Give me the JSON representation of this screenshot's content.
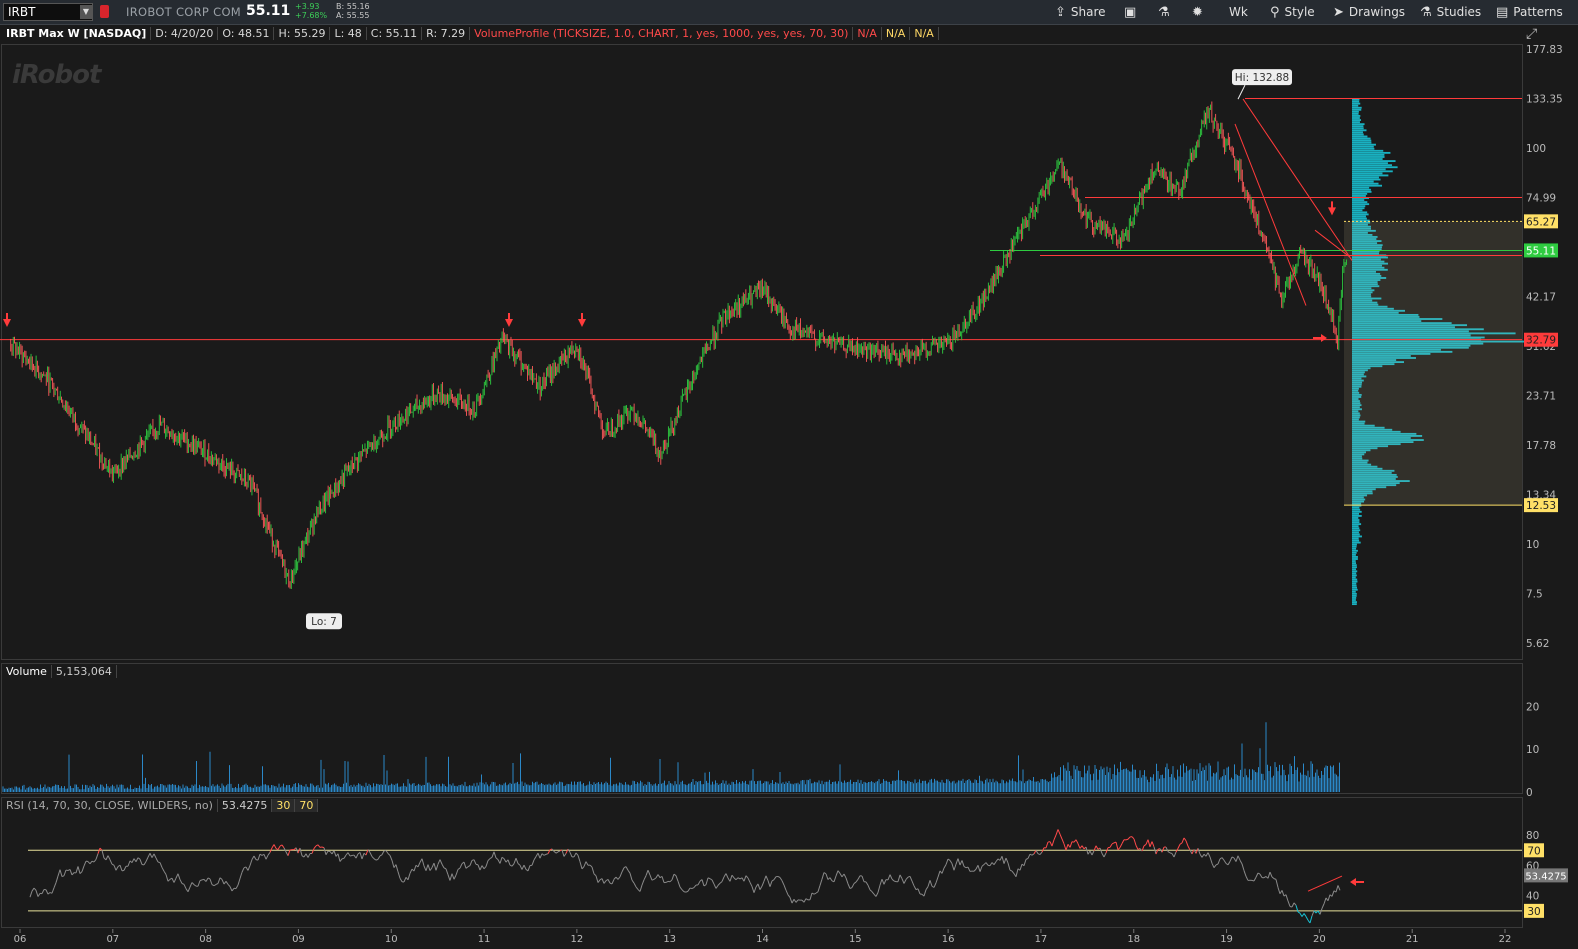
{
  "toolbar": {
    "symbol_value": "IRBT",
    "company": "IROBOT CORP COM",
    "last": "55.11",
    "change": "+3.93",
    "change_pct": "+7.68%",
    "bid": "B: 55.16",
    "ask": "A: 55.55",
    "share_label": "Share",
    "period_label": "Wk",
    "style_label": "Style",
    "drawings_label": "Drawings",
    "studies_label": "Studies",
    "patterns_label": "Patterns"
  },
  "info": {
    "title": "IRBT Max W [NASDAQ]",
    "date": "D: 4/20/20",
    "open": "O: 48.51",
    "high": "H: 55.29",
    "low": "L: 48",
    "close": "C: 55.11",
    "range": "R: 7.29",
    "volume_profile": "VolumeProfile (TICKSIZE, 1.0, CHART, 1, yes, 1000, yes, yes, 70, 30)",
    "na": "N/A"
  },
  "logo": "iRobot",
  "volume_panel": {
    "label": "Volume",
    "value": "5,153,064"
  },
  "rsi_panel": {
    "label": "RSI (14, 70, 30, CLOSE, WILDERS, no)",
    "value": "53.4275",
    "os": "30",
    "ob": "70"
  },
  "colors": {
    "up": "#2ecc40",
    "down": "#ff5a5a",
    "profile": "#19c2d4",
    "hline": "#ff3b3b",
    "green_line": "#2ecc40",
    "rsi_band": "#e8e09a"
  },
  "chart_data": [
    {
      "type": "line",
      "name": "price",
      "scale": "log",
      "ylim": [
        5.62,
        177.83
      ],
      "x_tick_labels": [
        "06",
        "07",
        "08",
        "09",
        "10",
        "11",
        "12",
        "13",
        "14",
        "15",
        "16",
        "17",
        "18",
        "19",
        "20",
        "21",
        "22"
      ],
      "y_tick_labels": [
        "177.83",
        "133.35",
        "100",
        "74.99",
        "42.17",
        "31.62",
        "23.71",
        "17.78",
        "13.34",
        "10",
        "7.5",
        "5.62"
      ],
      "x": [
        2005.9,
        2006.3,
        2006.7,
        2007.0,
        2007.5,
        2008.0,
        2008.5,
        2008.9,
        2009.2,
        2009.6,
        2010.0,
        2010.5,
        2010.9,
        2011.2,
        2011.6,
        2012.0,
        2012.3,
        2012.6,
        2012.9,
        2013.3,
        2013.6,
        2014.0,
        2014.3,
        2014.6,
        2015.0,
        2015.5,
        2016.0,
        2016.4,
        2016.8,
        2017.2,
        2017.5,
        2017.9,
        2018.2,
        2018.5,
        2018.8,
        2019.1,
        2019.3,
        2019.6,
        2019.8,
        2020.0,
        2020.2,
        2020.25,
        2020.3
      ],
      "close": [
        32,
        26,
        19,
        15,
        20,
        17,
        14,
        8,
        12,
        16,
        20,
        24,
        22,
        33,
        25,
        32,
        19,
        22,
        17,
        28,
        38,
        44,
        35,
        33,
        31,
        30,
        32,
        42,
        62,
        92,
        66,
        58,
        88,
        78,
        124,
        93,
        68,
        42,
        55,
        46,
        33,
        48,
        55
      ],
      "hi": 132.88,
      "lo": 7,
      "horizontal_levels": [
        133.35,
        74.99,
        53.5,
        32.8
      ],
      "green_level": 55.11,
      "profile_value_area": [
        65.27,
        12.53
      ],
      "price_labels": [
        "65.27",
        "55.11",
        "32.79",
        "12.53"
      ],
      "hi_label": "Hi: 132.88",
      "lo_label": "Lo: 7"
    },
    {
      "type": "bar",
      "name": "volume",
      "ylabel": "",
      "y_tick_labels": [
        "20",
        "10",
        "0"
      ],
      "ylim": [
        0,
        25
      ],
      "note_last_value": 5.153064
    },
    {
      "type": "line",
      "name": "rsi",
      "ylim": [
        20,
        90
      ],
      "y_tick_labels": [
        "80",
        "70",
        "60",
        "53.4275",
        "40",
        "30"
      ],
      "ob": 70,
      "os": 30,
      "last": 53.4275
    }
  ]
}
